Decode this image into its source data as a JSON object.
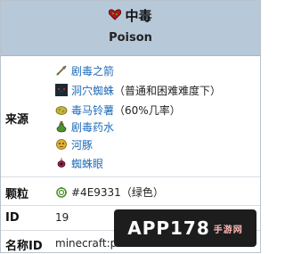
{
  "header": {
    "title": "中毒",
    "subtitle": "Poison"
  },
  "rows": {
    "source_label": "来源",
    "particle_label": "颗粒",
    "id_label": "ID",
    "nameid_label": "名称ID"
  },
  "sources": [
    {
      "icon": "arrow-icon",
      "text": "剧毒之箭",
      "link": true
    },
    {
      "icon": "cave-spider-icon",
      "text": "洞穴蜘蛛",
      "extra": "（普通和困难难度下）",
      "link": true
    },
    {
      "icon": "potato-icon",
      "text": "毒马铃薯",
      "extra": "（60%几率）",
      "link": true
    },
    {
      "icon": "potion-icon",
      "text": "剧毒药水",
      "link": true
    },
    {
      "icon": "pufferfish-icon",
      "text": "河豚",
      "link": true
    },
    {
      "icon": "spider-eye-icon",
      "text": "蜘蛛眼",
      "link": true
    }
  ],
  "particle": {
    "hex": "#4E9331",
    "note": "（绿色）"
  },
  "id_value": "19",
  "nameid_value": "minecraft:p",
  "watermark": {
    "brand": "APP178",
    "sub": "手游网"
  },
  "colors": {
    "header_bg": "#b7c8d9",
    "link": "#1f6bb8",
    "particle": "#4E9331"
  }
}
